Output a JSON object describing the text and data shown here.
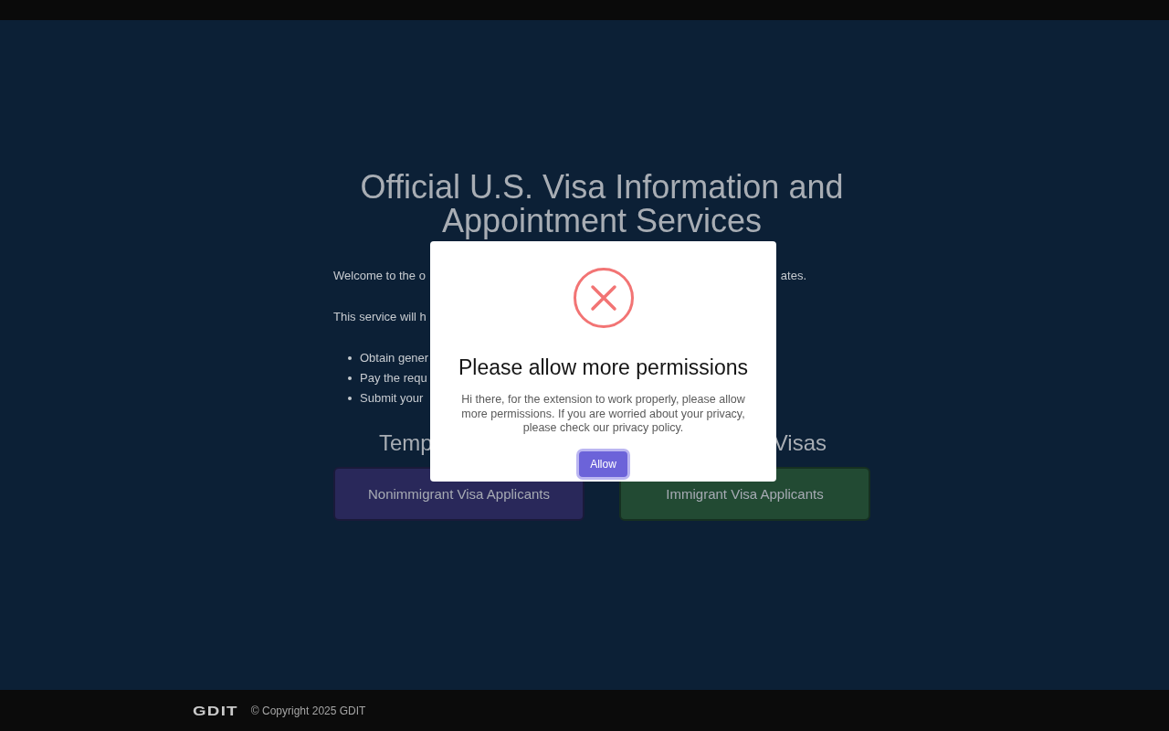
{
  "page": {
    "title": "Official U.S. Visa Information and Appointment Services",
    "intro": [
      {
        "left": "Welcome to the o",
        "right": "ates."
      },
      {
        "left": "This service will h"
      }
    ],
    "bullets": [
      "Obtain gener",
      "Pay the requ",
      "Submit your"
    ],
    "section_heading": {
      "left": "Temp",
      "right": "Visas"
    },
    "buttons": [
      {
        "label": "Nonimmigrant Visa Applicants",
        "color": "#29285a"
      },
      {
        "label": "Immigrant Visa Applicants",
        "color": "#224a33"
      }
    ]
  },
  "dialog": {
    "title": "Please allow more permissions",
    "message": "Hi there, for the extension to work properly, please allow more permissions. If you are worried about your privacy, please check our privacy policy.",
    "button": "Allow"
  },
  "footer": {
    "logo": "GDIT",
    "copyright": "© Copyright 2025 GDIT"
  }
}
